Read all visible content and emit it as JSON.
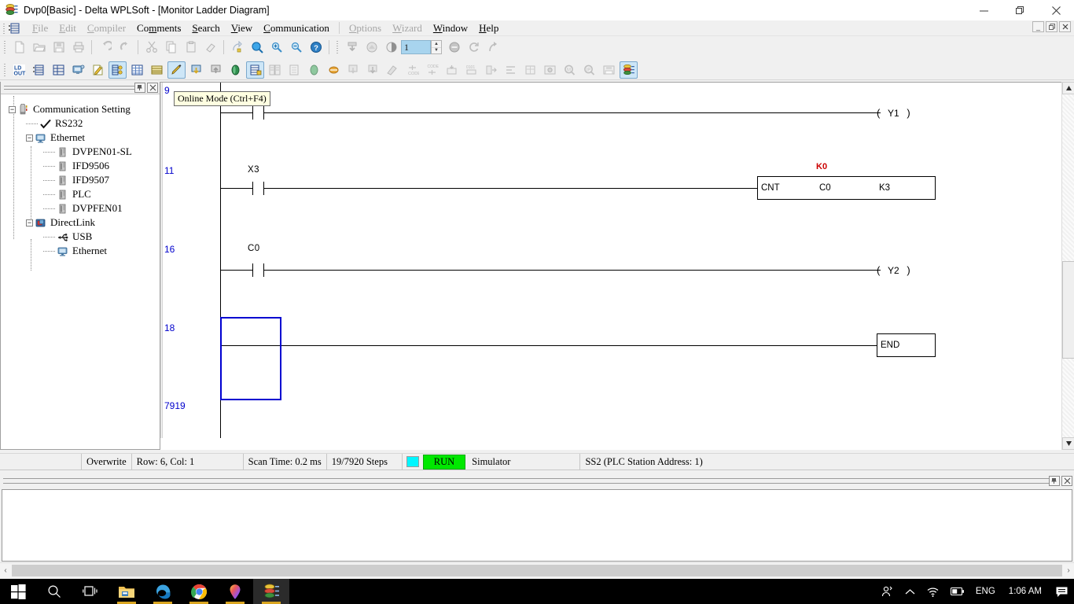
{
  "window": {
    "title": "Dvp0[Basic] - Delta WPLSoft - [Monitor Ladder Diagram]",
    "app_icon": "delta-wplsoft-icon",
    "minimize": "—",
    "maximize": "❐",
    "close": "✕"
  },
  "mdi_child": {
    "minimize": "_",
    "restore": "❐",
    "close": "✕"
  },
  "menu": {
    "items": [
      {
        "label": "File",
        "mnemonic": "F",
        "disabled": true
      },
      {
        "label": "Edit",
        "mnemonic": "E",
        "disabled": true
      },
      {
        "label": "Compiler",
        "mnemonic": "C",
        "disabled": true
      },
      {
        "label": "Comments",
        "mnemonic": "m",
        "disabled": false
      },
      {
        "label": "Search",
        "mnemonic": "S",
        "disabled": false
      },
      {
        "label": "View",
        "mnemonic": "V",
        "disabled": false
      },
      {
        "label": "Communication",
        "mnemonic": "C",
        "disabled": false
      },
      {
        "label": "Options",
        "mnemonic": "O",
        "disabled": true
      },
      {
        "label": "Wizard",
        "mnemonic": "W",
        "disabled": true
      },
      {
        "label": "Window",
        "mnemonic": "W",
        "disabled": false
      },
      {
        "label": "Help",
        "mnemonic": "H",
        "disabled": false
      }
    ]
  },
  "toolbar_standard": {
    "buttons": [
      {
        "name": "new-file-icon",
        "disabled": true
      },
      {
        "name": "open-file-icon",
        "disabled": true
      },
      {
        "name": "save-icon",
        "disabled": true
      },
      {
        "name": "print-icon",
        "disabled": true
      },
      {
        "name": "undo-icon",
        "disabled": true
      },
      {
        "name": "redo-icon",
        "disabled": true
      },
      {
        "name": "cut-icon",
        "disabled": true
      },
      {
        "name": "copy-icon",
        "disabled": true
      },
      {
        "name": "paste-icon",
        "disabled": true
      },
      {
        "name": "eraser-icon",
        "disabled": true
      },
      {
        "name": "goto-icon",
        "disabled": true
      },
      {
        "name": "zoom-icon",
        "disabled": false
      },
      {
        "name": "zoom-in-icon",
        "disabled": false
      },
      {
        "name": "zoom-out-icon",
        "disabled": false
      },
      {
        "name": "help-icon",
        "disabled": false
      }
    ],
    "step_value": "1",
    "extra_buttons": [
      {
        "name": "download-plc-icon",
        "disabled": true
      },
      {
        "name": "plc-write-icon",
        "disabled": true
      },
      {
        "name": "run-stop-icon",
        "disabled": true
      },
      {
        "name": "stop-circle-icon",
        "disabled": true
      },
      {
        "name": "refresh-icon",
        "disabled": true
      },
      {
        "name": "restore-arrow-icon",
        "disabled": true
      }
    ]
  },
  "toolbar_ladder": {
    "buttons": [
      {
        "name": "ld-out-icon",
        "state": "normal"
      },
      {
        "name": "ladder-view-icon",
        "state": "normal"
      },
      {
        "name": "instruction-list-icon",
        "state": "normal"
      },
      {
        "name": "plc-monitor-icon",
        "state": "normal"
      },
      {
        "name": "edit-comment-icon",
        "state": "normal"
      },
      {
        "name": "device-monitor-icon",
        "state": "active"
      },
      {
        "name": "register-table-icon",
        "state": "normal"
      },
      {
        "name": "device-list-icon",
        "state": "normal"
      },
      {
        "name": "online-mode-icon",
        "state": "active"
      },
      {
        "name": "download-to-plc-icon",
        "state": "normal"
      },
      {
        "name": "upload-from-plc-icon",
        "state": "normal"
      },
      {
        "name": "plc-status-icon",
        "state": "normal"
      },
      {
        "name": "monitor-ladder-icon",
        "state": "active"
      },
      {
        "name": "program-compare-icon",
        "state": "disabled"
      },
      {
        "name": "document-icon",
        "state": "disabled"
      },
      {
        "name": "plc-run-icon",
        "state": "disabled"
      },
      {
        "name": "plc-stop-icon",
        "state": "disabled"
      },
      {
        "name": "write-program-icon",
        "state": "disabled"
      },
      {
        "name": "read-program-icon",
        "state": "disabled"
      },
      {
        "name": "delete-program-icon",
        "state": "disabled"
      },
      {
        "name": "code-check-icon",
        "state": "disabled"
      },
      {
        "name": "code-convert-icon",
        "state": "disabled"
      },
      {
        "name": "bit-monitor-icon",
        "state": "disabled"
      },
      {
        "name": "word-monitor-icon",
        "state": "disabled"
      },
      {
        "name": "step-run-icon",
        "state": "disabled"
      },
      {
        "name": "align-icon",
        "state": "disabled"
      },
      {
        "name": "table-edit-icon",
        "state": "disabled"
      },
      {
        "name": "photo-icon",
        "state": "disabled"
      },
      {
        "name": "find-m-icon",
        "state": "disabled"
      },
      {
        "name": "find-ip-icon",
        "state": "disabled"
      },
      {
        "name": "save-memory-icon",
        "state": "disabled"
      },
      {
        "name": "simulator-icon",
        "state": "active"
      }
    ]
  },
  "tooltip": {
    "text": "Online Mode (Ctrl+F4)"
  },
  "tree_panel": {
    "pin_label": "⚑",
    "close_label": "✕",
    "nodes": [
      {
        "label": "Communication Setting",
        "icon": "comm-setting-icon",
        "level": 0,
        "expander": "-"
      },
      {
        "label": "RS232",
        "icon": "check-icon",
        "level": 1,
        "expander": ""
      },
      {
        "label": "Ethernet",
        "icon": "ethernet-icon",
        "level": 1,
        "expander": "-"
      },
      {
        "label": "DVPEN01-SL",
        "icon": "module-icon",
        "level": 2,
        "expander": ""
      },
      {
        "label": "IFD9506",
        "icon": "module-icon",
        "level": 2,
        "expander": ""
      },
      {
        "label": "IFD9507",
        "icon": "module-icon",
        "level": 2,
        "expander": ""
      },
      {
        "label": "PLC",
        "icon": "module-icon",
        "level": 2,
        "expander": ""
      },
      {
        "label": "DVPFEN01",
        "icon": "module-icon",
        "level": 2,
        "expander": ""
      },
      {
        "label": "DirectLink",
        "icon": "directlink-icon",
        "level": 1,
        "expander": "-"
      },
      {
        "label": "USB",
        "icon": "usb-icon",
        "level": 2,
        "expander": ""
      },
      {
        "label": "Ethernet",
        "icon": "ethernet-icon",
        "level": 2,
        "expander": ""
      }
    ]
  },
  "ladder": {
    "rung_numbers": [
      "9",
      "11",
      "16",
      "18",
      "7919"
    ],
    "rungs": [
      {
        "step": "9",
        "contact": {
          "label": "",
          "type": "NO"
        },
        "output": {
          "type": "coil",
          "device": "Y1"
        }
      },
      {
        "step": "11",
        "contact": {
          "label": "X3",
          "type": "NO"
        },
        "output": {
          "type": "instruction",
          "mnemonic": "CNT",
          "operand1": "C0",
          "operand2": "K3",
          "monitor_value": "K0"
        }
      },
      {
        "step": "16",
        "contact": {
          "label": "C0",
          "type": "NO"
        },
        "output": {
          "type": "coil",
          "device": "Y2"
        }
      },
      {
        "step": "18",
        "contact": null,
        "output": {
          "type": "instruction",
          "mnemonic": "END"
        }
      }
    ],
    "end_label": "END",
    "coil_open": "(",
    "coil_close": ")"
  },
  "statusbar": {
    "mode": "Overwrite",
    "position": "Row: 6, Col: 1",
    "scan_time": "Scan Time: 0.2 ms",
    "steps": "19/7920 Steps",
    "run_label": "RUN",
    "run_color": "#00e800",
    "led_color": "#00f6ff",
    "connection": "Simulator",
    "plc": "SS2 (PLC Station Address: 1)"
  },
  "output_pane": {
    "pin_label": "⚑",
    "close_label": "✕",
    "content": ""
  },
  "scrollbar": {
    "up_arrow": "▲",
    "down_arrow": "▼",
    "left_arrow": "‹",
    "right_arrow": "›"
  },
  "taskbar": {
    "items": [
      {
        "name": "start-button",
        "icon": "windows-logo-icon"
      },
      {
        "name": "search-button",
        "icon": "search-icon"
      },
      {
        "name": "task-view-button",
        "icon": "task-view-icon"
      },
      {
        "name": "file-explorer-button",
        "icon": "folder-icon",
        "running": true
      },
      {
        "name": "edge-button",
        "icon": "edge-icon",
        "running": true
      },
      {
        "name": "chrome-button",
        "icon": "chrome-icon",
        "running": true
      },
      {
        "name": "maps-button",
        "icon": "map-pin-icon",
        "running": true
      },
      {
        "name": "wplsoft-button",
        "icon": "delta-wplsoft-icon",
        "running": true,
        "focused": true
      }
    ],
    "tray": [
      {
        "name": "people-icon",
        "glyph": "ღ"
      },
      {
        "name": "chevron-up-icon",
        "glyph": "∧"
      },
      {
        "name": "wifi-icon",
        "glyph": "wifi"
      },
      {
        "name": "battery-icon",
        "glyph": "battery"
      },
      {
        "name": "language-indicator",
        "glyph": "ENG"
      }
    ],
    "clock": "1:06 AM",
    "notification_icon": "notification-icon"
  }
}
